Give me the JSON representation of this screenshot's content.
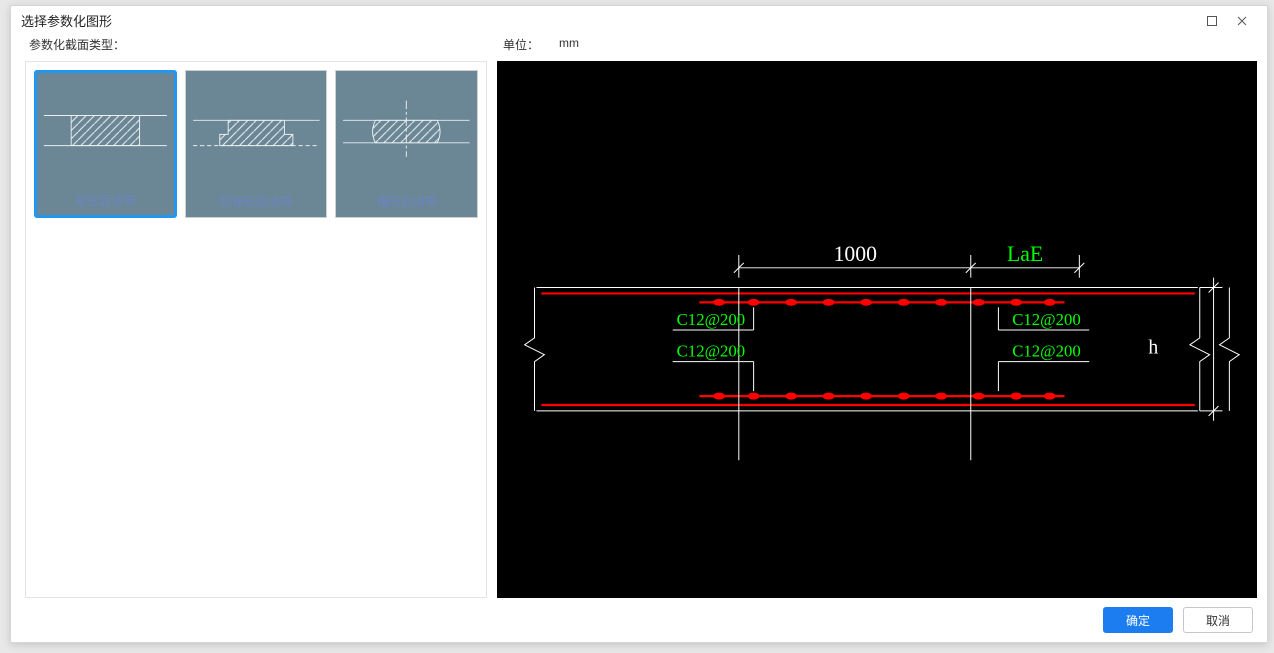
{
  "window": {
    "title": "选择参数化图形"
  },
  "left": {
    "label": "参数化截面类型：",
    "thumbs": [
      {
        "label": "矩形后浇带",
        "selected": true
      },
      {
        "label": "阶梯形后浇带",
        "selected": false
      },
      {
        "label": "槽形后浇带",
        "selected": false
      }
    ]
  },
  "right": {
    "unit_label": "单位：",
    "unit_value": "mm"
  },
  "drawing": {
    "dim_width": "1000",
    "dim_ext": "LaE",
    "dim_height": "h",
    "rebar_spec_top_left": "C12@200",
    "rebar_spec_top_right": "C12@200",
    "rebar_spec_bot_left": "C12@200",
    "rebar_spec_bot_right": "C12@200"
  },
  "buttons": {
    "ok": "确定",
    "cancel": "取消"
  },
  "icons": {
    "maximize": "maximize-icon",
    "close": "close-icon"
  }
}
